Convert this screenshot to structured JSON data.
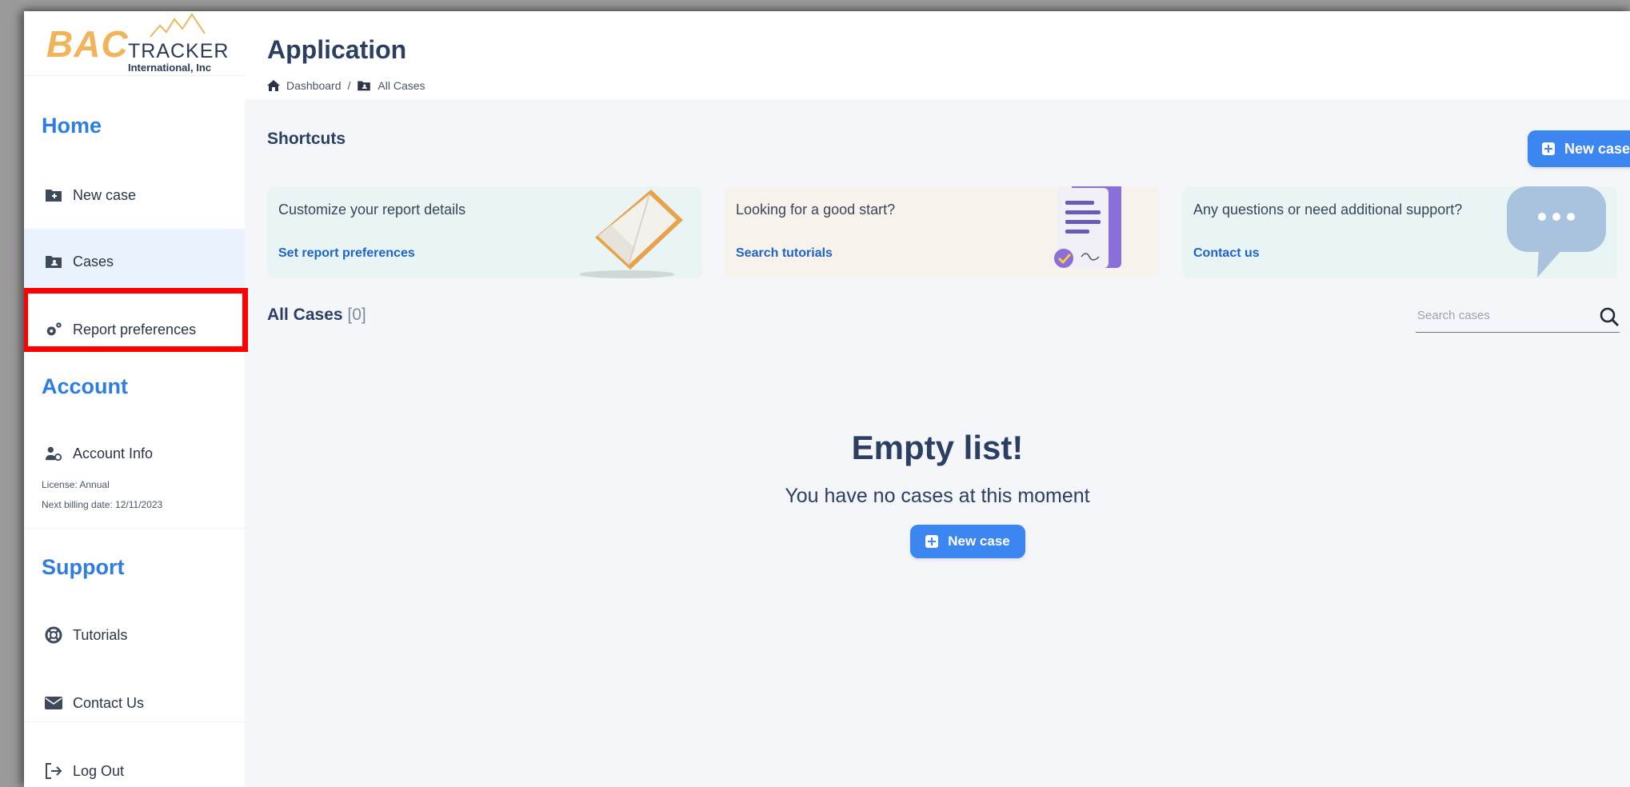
{
  "logo": {
    "brand": "BAC",
    "tracker": "TRACKER",
    "company": "International, Inc"
  },
  "sidebar": {
    "home_title": "Home",
    "items_home": [
      {
        "label": "New case",
        "icon": "folder-plus-icon"
      },
      {
        "label": "Cases",
        "icon": "folder-user-icon"
      },
      {
        "label": "Report preferences",
        "icon": "gears-icon"
      }
    ],
    "account_title": "Account",
    "account_info": {
      "label": "Account Info",
      "icon": "user-gear-icon"
    },
    "license": "License: Annual",
    "billing": "Next billing date: 12/11/2023",
    "support_title": "Support",
    "items_support": [
      {
        "label": "Tutorials",
        "icon": "lifebuoy-icon"
      },
      {
        "label": "Contact Us",
        "icon": "envelope-icon"
      }
    ],
    "logout": {
      "label": "Log Out",
      "icon": "logout-icon"
    }
  },
  "header": {
    "title": "Application",
    "breadcrumb": [
      "Dashboard",
      "/",
      "All Cases"
    ]
  },
  "shortcuts": {
    "title": "Shortcuts",
    "new_case_label": "New case",
    "cards": [
      {
        "text": "Customize your report details",
        "link": "Set report preferences",
        "bg": "#e9f4f4"
      },
      {
        "text": "Looking for a good start?",
        "link": "Search tutorials",
        "bg": "#f8f2ec"
      },
      {
        "text": "Any questions or need additional support?",
        "link": "Contact us",
        "bg": "#e9f4f4"
      }
    ]
  },
  "cases": {
    "title": "All Cases",
    "count": "[0]",
    "search_placeholder": "Search cases",
    "empty_title": "Empty list!",
    "empty_sub": "You have no cases at this moment",
    "new_case_label": "New case"
  },
  "colors": {
    "accent": "#3b86f0",
    "section": "#2e7de0",
    "text_dark": "#2b3f63",
    "highlight": "#ff0000"
  }
}
